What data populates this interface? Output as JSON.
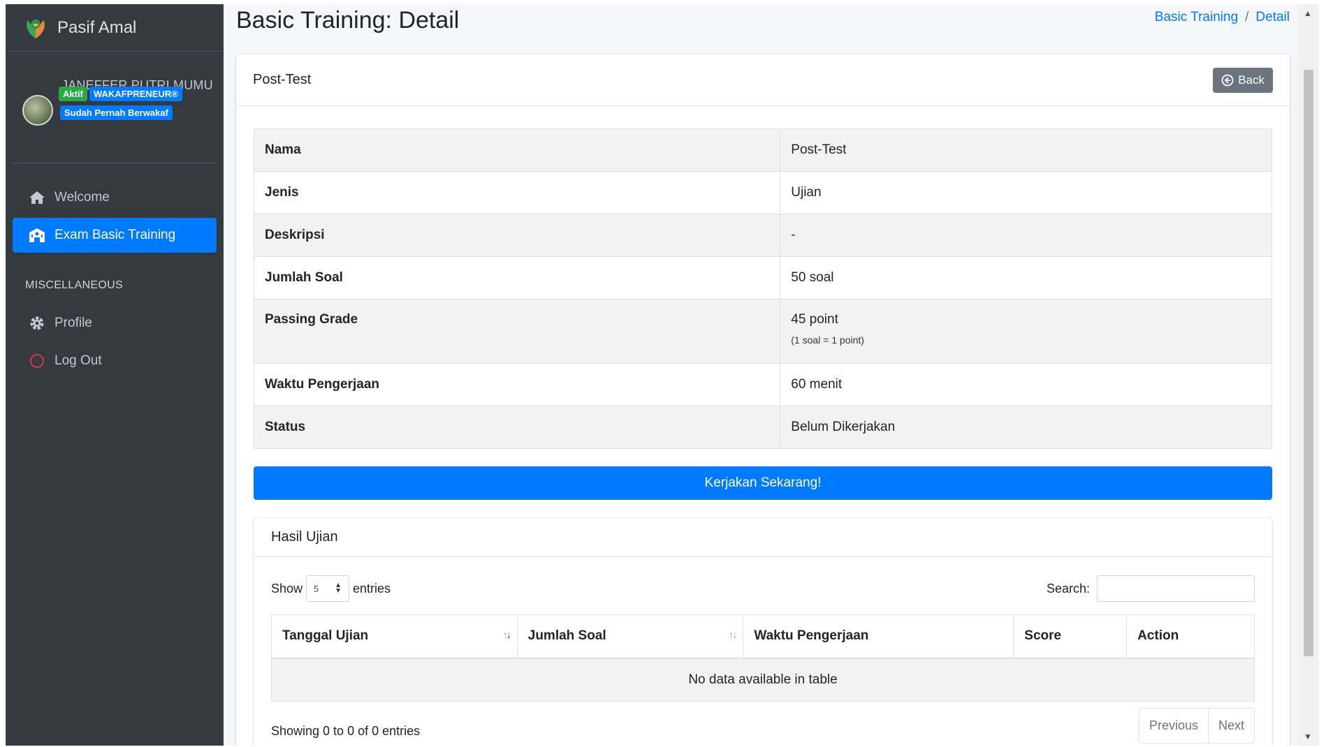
{
  "brand": {
    "name": "Pasif Amal"
  },
  "user": {
    "name": "JANEFFER PUTRI MUMU",
    "badges": [
      "Aktif",
      "WAKAFPRENEUR®",
      "Sudah Pernah Berwakaf"
    ]
  },
  "nav": {
    "items": [
      {
        "label": "Welcome",
        "icon": "home-icon"
      },
      {
        "label": "Exam Basic Training",
        "icon": "school-icon",
        "active": true
      }
    ],
    "misc_header": "MISCELLANEOUS",
    "misc_items": [
      {
        "label": "Profile",
        "icon": "gear-icon"
      },
      {
        "label": "Log Out",
        "icon": "circle-icon"
      }
    ]
  },
  "page": {
    "title": "Basic Training: Detail",
    "breadcrumb": [
      "Basic Training",
      "Detail"
    ]
  },
  "card": {
    "title": "Post-Test",
    "back_label": "Back"
  },
  "info": {
    "rows": [
      {
        "key": "Nama",
        "value": "Post-Test"
      },
      {
        "key": "Jenis",
        "value": "Ujian"
      },
      {
        "key": "Deskripsi",
        "value": "-"
      },
      {
        "key": "Jumlah Soal",
        "value": "50 soal"
      },
      {
        "key": "Passing Grade",
        "value": "45 point",
        "note": "(1 soal = 1 point)"
      },
      {
        "key": "Waktu Pengerjaan",
        "value": "60 menit"
      },
      {
        "key": "Status",
        "value": "Belum Dikerjakan"
      }
    ]
  },
  "action": {
    "start_label": "Kerjakan Sekarang!"
  },
  "results": {
    "title": "Hasil Ujian",
    "show_label": "Show",
    "entries_value": "5",
    "entries_label": "entries",
    "search_label": "Search:",
    "search_value": "",
    "columns": [
      "Tanggal Ujian",
      "Jumlah Soal",
      "Waktu Pengerjaan",
      "Score",
      "Action"
    ],
    "empty_text": "No data available in table",
    "info_text": "Showing 0 to 0 of 0 entries",
    "prev_label": "Previous",
    "next_label": "Next"
  },
  "colors": {
    "sidebar_bg": "#343a40",
    "primary": "#007bff",
    "success": "#28a745",
    "secondary": "#6c757d",
    "content_bg": "#f4f6f9"
  }
}
